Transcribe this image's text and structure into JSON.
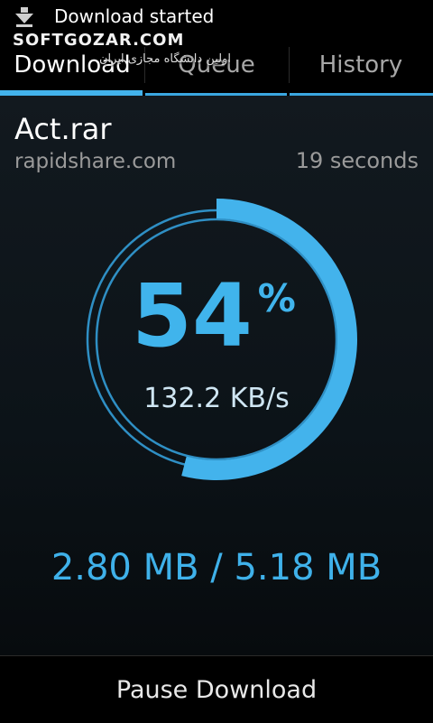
{
  "statusbar": {
    "notification": "Download started"
  },
  "watermark": {
    "text": "SOFTGOZAR.COM",
    "subtext": "اولین دانشگاه مجازی ایران"
  },
  "tabs": [
    {
      "label": "Download",
      "active": true
    },
    {
      "label": "Queue",
      "active": false
    },
    {
      "label": "History",
      "active": false
    }
  ],
  "download": {
    "filename": "Act.rar",
    "host": "rapidshare.com",
    "eta": "19 seconds",
    "percent_value": "54",
    "percent_sign": "%",
    "progress": 0.54,
    "speed": "132.2 KB/s",
    "size": "2.80 MB / 5.18 MB"
  },
  "actions": {
    "pause_label": "Pause Download"
  },
  "colors": {
    "accent": "#43b3ec",
    "ring_track": "#2f8fc4"
  }
}
